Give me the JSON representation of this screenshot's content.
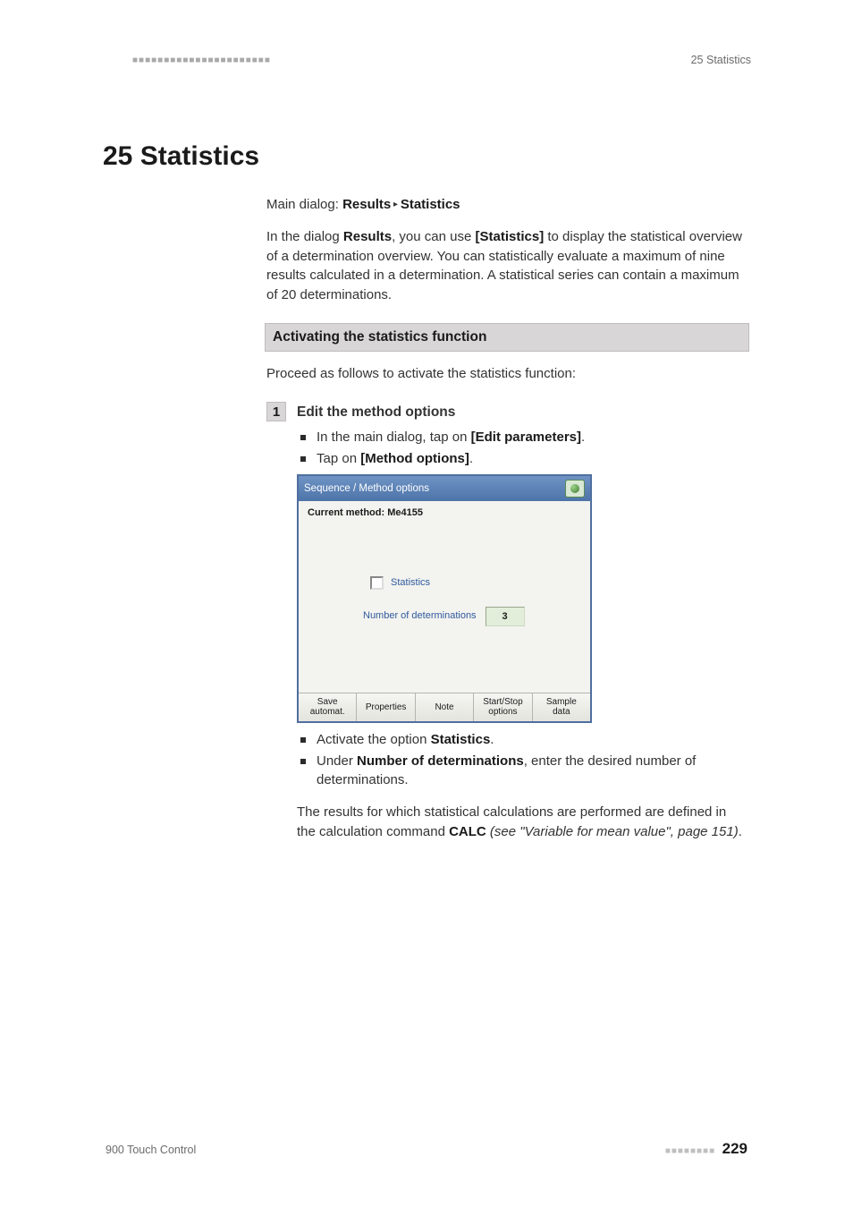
{
  "header": {
    "squares": "■■■■■■■■■■■■■■■■■■■■■■",
    "section_label": "25 Statistics"
  },
  "chapter_title": "25 Statistics",
  "dialog_path": {
    "prefix": "Main dialog: ",
    "part1": "Results",
    "sep": " ▸ ",
    "part2": "Statistics"
  },
  "intro": {
    "t1": "In the dialog ",
    "b1": "Results",
    "t2": ", you can use ",
    "b2": "[Statistics]",
    "t3": " to display the statistical overview of a determination overview. You can statistically evaluate a maximum of nine results calculated in a determination. A statistical series can contain a maximum of 20 determinations."
  },
  "sub_heading": "Activating the statistics function",
  "proceed": "Proceed as follows to activate the statistics function:",
  "step": {
    "num": "1",
    "title": "Edit the method options",
    "pre_bullets": [
      {
        "t1": "In the main dialog, tap on ",
        "b1": "[Edit parameters]",
        "t2": "."
      },
      {
        "t1": "Tap on ",
        "b1": "[Method options]",
        "t2": "."
      }
    ],
    "screenshot": {
      "header_title": "Sequence / Method options",
      "current_method_label": "Current method: Me4155",
      "stat_label": "Statistics",
      "num_label": "Number of determinations",
      "num_value": "3",
      "tabs": [
        "Save\nautomat.",
        "Properties",
        "Note",
        "Start/Stop\noptions",
        "Sample\ndata"
      ]
    },
    "post_bullets": [
      {
        "t1": "Activate the option ",
        "b1": "Statistics",
        "t2": "."
      },
      {
        "t1": "Under ",
        "b1": "Number of determinations",
        "t2": ", enter the desired number of determinations."
      }
    ],
    "result_para": {
      "t1": "The results for which statistical calculations are performed are defined in the calculation command ",
      "b1": "CALC",
      "i1": " (see \"Variable for mean value\", page 151)",
      "t2": "."
    }
  },
  "footer": {
    "product": "900 Touch Control",
    "squares": "■■■■■■■■",
    "page": "229"
  }
}
